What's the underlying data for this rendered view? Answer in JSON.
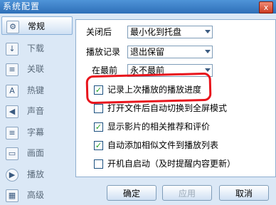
{
  "window": {
    "title": "系统配置",
    "close_label": "x"
  },
  "sidebar": {
    "items": [
      {
        "label": "常规",
        "icon": "gear-icon",
        "glyph": "⚙",
        "active": true
      },
      {
        "label": "下载",
        "icon": "download-icon",
        "glyph": "↓",
        "active": false
      },
      {
        "label": "关联",
        "icon": "document-icon",
        "glyph": "≡",
        "active": false
      },
      {
        "label": "热键",
        "icon": "keyboard-icon",
        "glyph": "A",
        "active": false
      },
      {
        "label": "声音",
        "icon": "speaker-icon",
        "glyph": "◀",
        "active": false
      },
      {
        "label": "字幕",
        "icon": "subtitle-icon",
        "glyph": "≡",
        "active": false
      },
      {
        "label": "画面",
        "icon": "screen-icon",
        "glyph": "▭",
        "active": false
      },
      {
        "label": "播放",
        "icon": "play-icon",
        "glyph": "▶",
        "active": false
      },
      {
        "label": "高级",
        "icon": "advanced-icon",
        "glyph": "▦",
        "active": false
      }
    ]
  },
  "settings": {
    "close_after": {
      "label": "关闭后",
      "value": "最小化到托盘"
    },
    "playback_log": {
      "label": "播放记录",
      "value": "退出保留"
    },
    "always_top": {
      "label": "在最前",
      "value": "永不最前"
    },
    "checks": [
      {
        "label": "记录上次播放的播放进度",
        "checked": true
      },
      {
        "label": "打开文件后自动切换到全屏模式",
        "checked": false
      },
      {
        "label": "显示影片的相关推荐和评价",
        "checked": true
      },
      {
        "label": "自动添加相似文件到播放列表",
        "checked": true
      },
      {
        "label": "开机自启动（及时提醒内容更新）",
        "checked": false
      }
    ]
  },
  "buttons": {
    "ok": "确定",
    "apply": "应用",
    "cancel": "取消"
  },
  "colors": {
    "highlight": "#e8141c",
    "check": "#21a121"
  }
}
